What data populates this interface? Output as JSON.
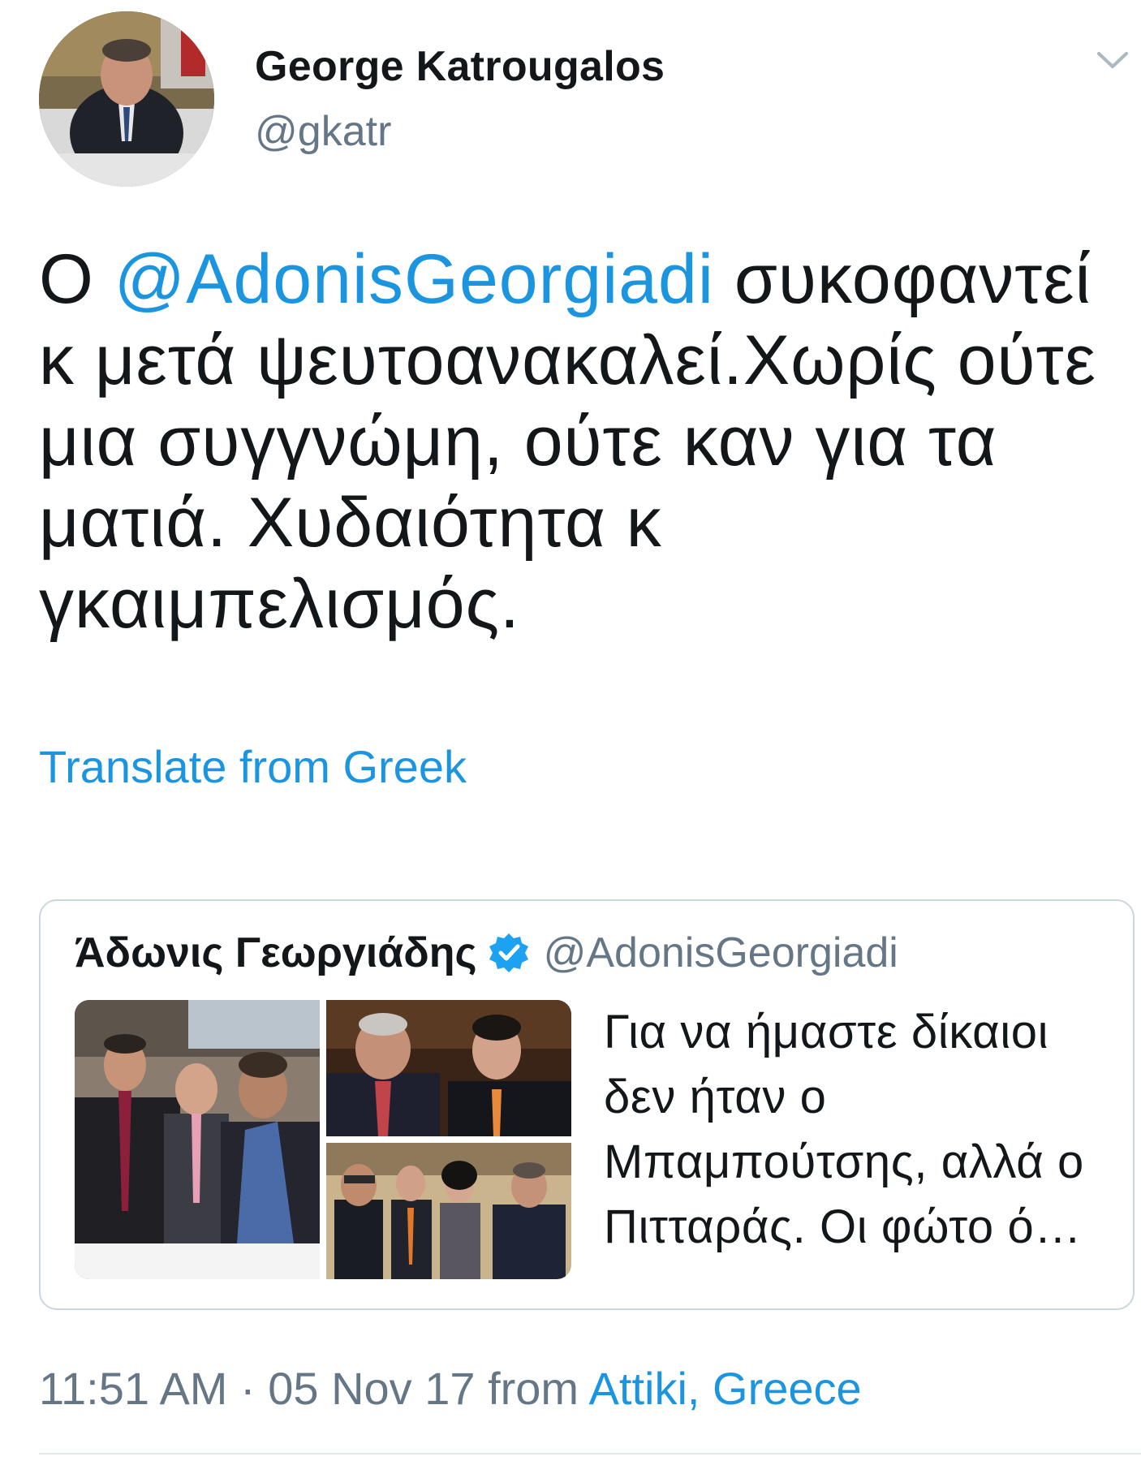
{
  "author": {
    "display_name": "George Katrougalos",
    "handle": "@gkatr"
  },
  "tweet": {
    "text_before": "Ο ",
    "mention": "@AdonisGeorgiadi",
    "text_after": " συκοφαντεί κ μετά ψευτοανακαλεί.Χωρίς ούτε μια συγγνώμη, ούτε καν για τα ματιά. Χυδαιότητα κ γκαιμπελισμός."
  },
  "translate_label": "Translate from Greek",
  "quote": {
    "display_name": "Άδωνις Γεωργιάδης",
    "verified": true,
    "handle": "@AdonisGeorgiadi",
    "text": "Για να ήμαστε δίκαιοι δεν ήταν ο Μπαμπούτσης, αλλά ο Πιτταράς. Οι φώτο ό…"
  },
  "meta": {
    "time": "11:51 AM",
    "separator": "·",
    "date": "05 Nov 17",
    "from": "from",
    "location": "Attiki, Greece"
  },
  "colors": {
    "link": "#1b95e0",
    "secondary_text": "#657786",
    "border": "#ccd6dd"
  },
  "icons": {
    "chevron": "chevron-down-icon",
    "verified": "verified-badge-icon"
  }
}
